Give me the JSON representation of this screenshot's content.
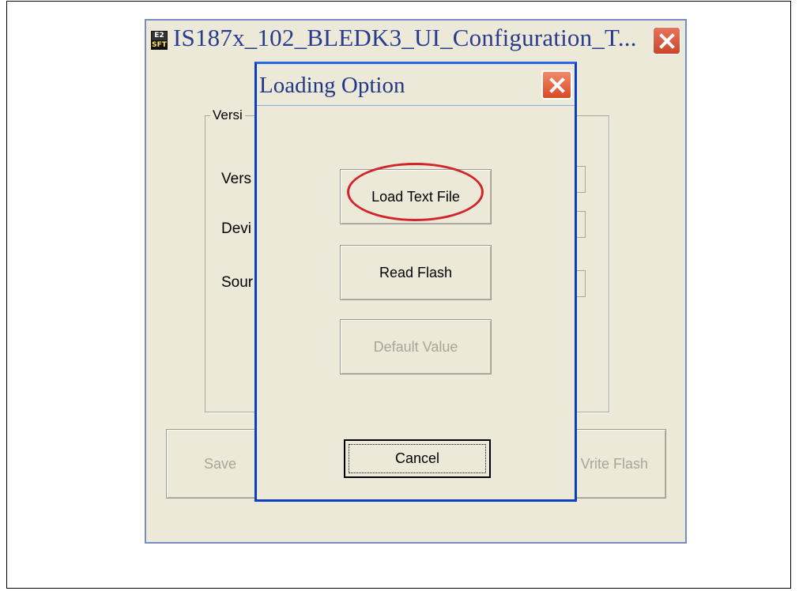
{
  "main_window": {
    "icon_text_top": "E2",
    "icon_text_bottom": "SFT",
    "title": "IS187x_102_BLEDK3_UI_Configuration_T...",
    "group_label": "Versi",
    "labels": [
      "Vers",
      "Devi",
      "Sour"
    ],
    "save_label": "Save",
    "write_flash_label": "Vrite Flash"
  },
  "dialog": {
    "title": "Loading Option",
    "buttons": {
      "load_text_file": "Load Text File",
      "read_flash": "Read Flash",
      "default_value": "Default Value",
      "cancel": "Cancel"
    }
  },
  "colors": {
    "window_bg": "#ece9d8",
    "dialog_border": "#0a3fc4",
    "close_button": "#d94a25",
    "highlight_oval": "#d2242a"
  }
}
